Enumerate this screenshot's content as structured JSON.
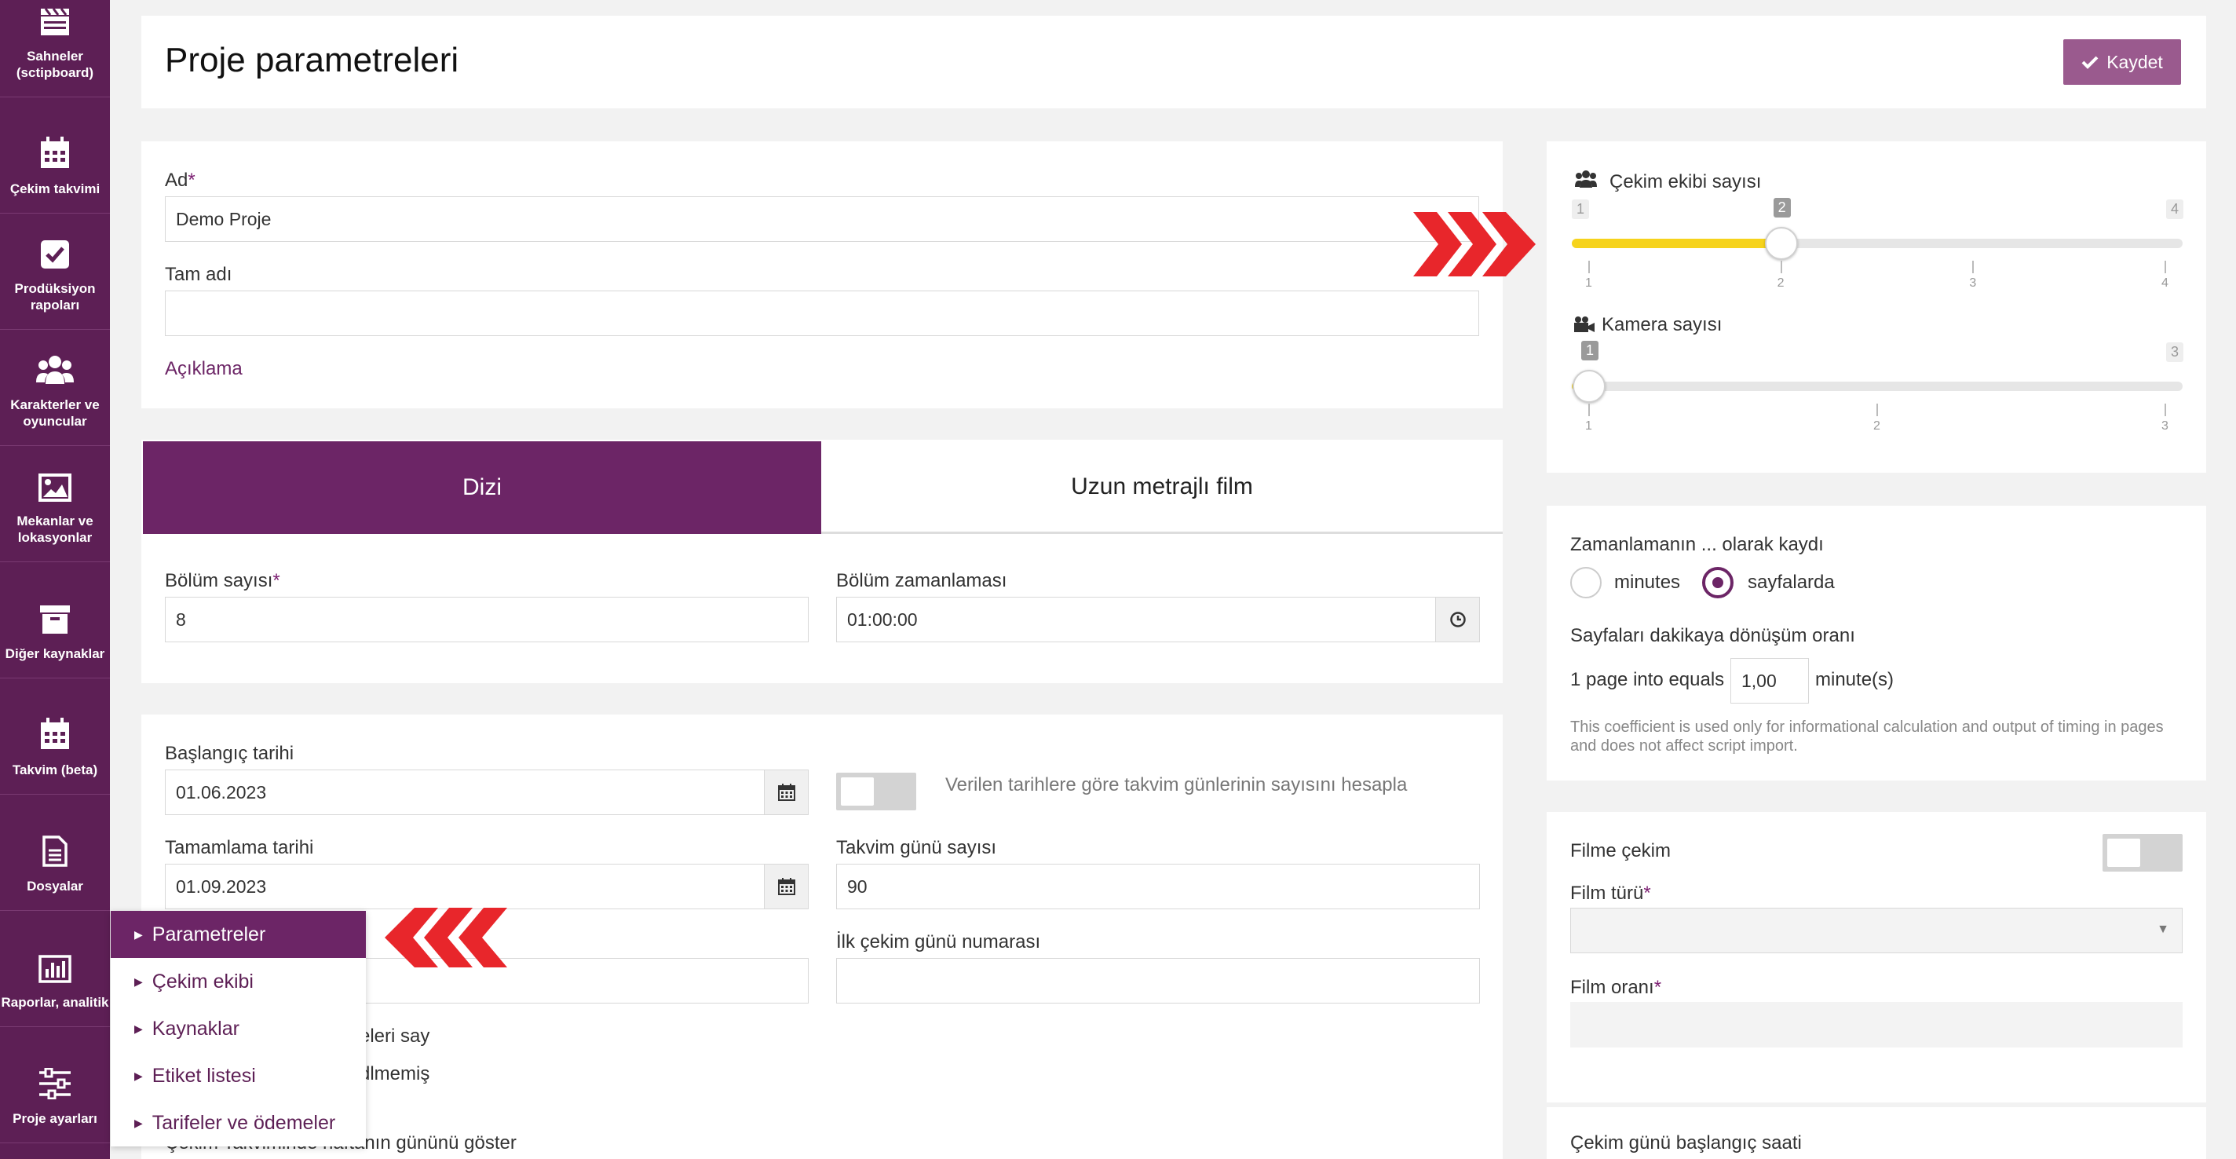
{
  "sidebar": {
    "items": [
      {
        "label": "Sahneler (sctipboard)",
        "icon": "clapperboard-icon"
      },
      {
        "label": "Çekim takvimi",
        "icon": "calendar-icon"
      },
      {
        "label": "Prodüksiyon rapoları",
        "icon": "check-square-icon"
      },
      {
        "label": "Karakterler ve oyuncular",
        "icon": "users-icon"
      },
      {
        "label": "Mekanlar ve lokasyonlar",
        "icon": "image-icon"
      },
      {
        "label": "Diğer kaynaklar",
        "icon": "archive-icon"
      },
      {
        "label": "Takvim (beta)",
        "icon": "calendar-icon"
      },
      {
        "label": "Dosyalar",
        "icon": "file-icon"
      },
      {
        "label": "Raporlar, analitik",
        "icon": "bar-chart-icon"
      },
      {
        "label": "Proje ayarları",
        "icon": "sliders-icon"
      }
    ]
  },
  "header": {
    "title": "Proje parametreleri",
    "save_label": "Kaydet"
  },
  "basic": {
    "name_label": "Ad",
    "name_value": "Demo Proje",
    "fullname_label": "Tam adı",
    "fullname_value": "",
    "description_link": "Açıklama"
  },
  "tabs": {
    "series": "Dizi",
    "feature": "Uzun metrajlı film"
  },
  "series": {
    "episodes_label": "Bölüm sayısı",
    "episodes_value": "8",
    "episode_timing_label": "Bölüm zamanlaması",
    "episode_timing_value": "01:00:00"
  },
  "dates": {
    "start_label": "Başlangıç tarihi",
    "start_value": "01.06.2023",
    "calc_toggle_label": "Verilen tarihlere göre takvim günlerinin sayısını hesapla",
    "end_label": "Tamamlama tarihi",
    "end_value": "01.09.2023",
    "calendar_days_label": "Takvim günü sayısı",
    "calendar_days_value": "90",
    "first_day_label": "İlk çekim günü numarası",
    "first_day_value": "",
    "hidden_text_1": "eleri say",
    "hidden_text_2": "dlmemiş",
    "hidden_text_3": "Çekim Takviminde haftanın gününü göster"
  },
  "crew": {
    "crew_label": "Çekim ekibi sayısı",
    "crew_min": "1",
    "crew_value": "2",
    "crew_max": "4",
    "crew_ticks": [
      "1",
      "2",
      "3",
      "4"
    ],
    "crew_fraction": 0.3333,
    "camera_label": "Kamera sayısı",
    "camera_value": "1",
    "camera_max": "3",
    "camera_ticks": [
      "1",
      "2",
      "3"
    ],
    "camera_fraction": 0.0
  },
  "timing": {
    "recorded_as_label": "Zamanlamanın ... olarak kaydı",
    "option_minutes": "minutes",
    "option_pages": "sayfalarda",
    "selected": "sayfalarda",
    "conversion_label": "Sayfaları dakikaya dönüşüm oranı",
    "page_equals": "1 page into equals",
    "ratio_value": "1,00",
    "minutes_unit": "minute(s)",
    "note": "This coefficient is used only for informational calculation and output of timing in pages and does not affect script import."
  },
  "film": {
    "film_shoot_label": "Filme çekim",
    "film_type_label": "Film türü",
    "film_type_value": "",
    "film_ratio_label": "Film oranı",
    "film_ratio_value": ""
  },
  "shoot_start": {
    "label": "Çekim günü başlangıç saati"
  },
  "menu": {
    "items": [
      "Parametreler",
      "Çekim ekibi",
      "Kaynaklar",
      "Etiket listesi",
      "Tarifeler ve ödemeler"
    ],
    "active": "Parametreler"
  },
  "colors": {
    "brand": "#5d1f55",
    "accent": "#6c2566",
    "slider_fill": "#f6d31c",
    "arrow": "#e8262b"
  }
}
